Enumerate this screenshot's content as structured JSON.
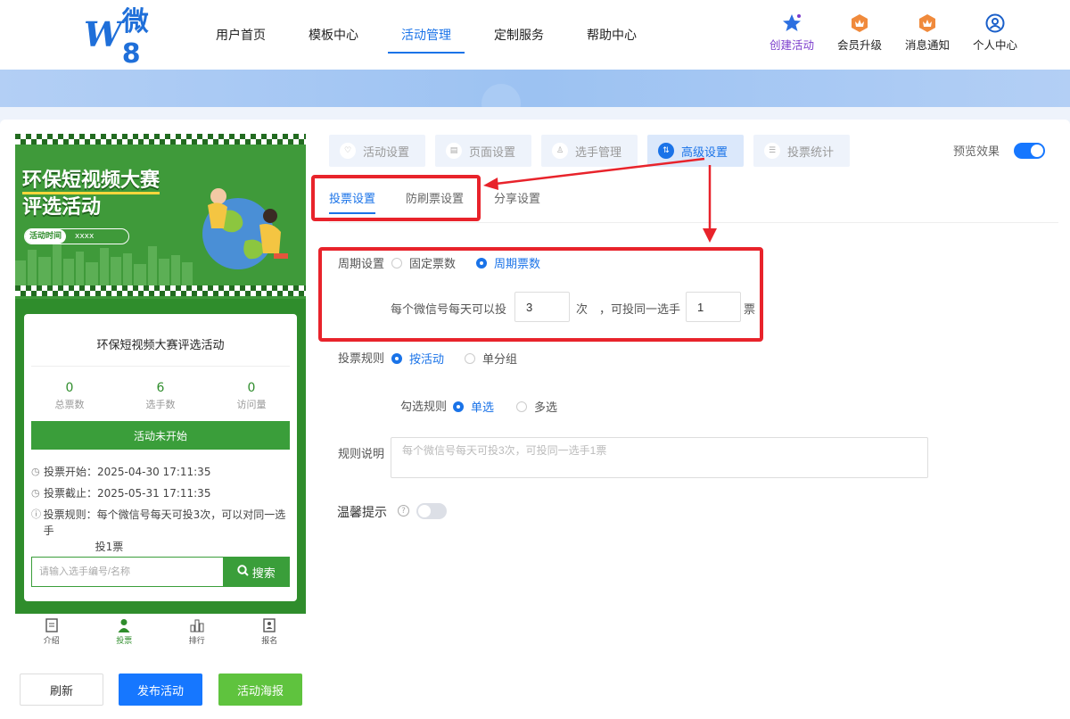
{
  "logo": {
    "mark": "W",
    "text": "微8"
  },
  "nav": {
    "items": [
      {
        "label": "用户首页"
      },
      {
        "label": "模板中心"
      },
      {
        "label": "活动管理"
      },
      {
        "label": "定制服务"
      },
      {
        "label": "帮助中心"
      }
    ],
    "right": [
      {
        "label": "创建活动",
        "icon": "star-icon"
      },
      {
        "label": "会员升级",
        "icon": "crown-icon"
      },
      {
        "label": "消息通知",
        "icon": "bell-icon"
      },
      {
        "label": "个人中心",
        "icon": "user-icon"
      }
    ]
  },
  "preview": {
    "poster_title_1": "环保短视频大赛",
    "poster_title_2": "评选活动",
    "time_label": "活动时间",
    "time_value": "xxxx",
    "card_title": "环保短视频大赛评选活动",
    "stats": [
      {
        "num": "0",
        "label": "总票数"
      },
      {
        "num": "6",
        "label": "选手数"
      },
      {
        "num": "0",
        "label": "访问量"
      }
    ],
    "status": "活动未开始",
    "vote_start": "投票开始：2025-04-30 17:11:35",
    "vote_end": "投票截止：2025-05-31 17:11:35",
    "vote_rule_1": "投票规则：每个微信号每天可投3次，可以对同一选手",
    "vote_rule_2": "投1票",
    "search_placeholder": "请输入选手编号/名称",
    "search_btn": "搜索",
    "tabs": [
      {
        "label": "介绍"
      },
      {
        "label": "投票"
      },
      {
        "label": "排行"
      },
      {
        "label": "报名"
      }
    ]
  },
  "bottom_buttons": {
    "refresh": "刷新",
    "publish": "发布活动",
    "poster": "活动海报"
  },
  "steps": [
    {
      "label": "活动设置"
    },
    {
      "label": "页面设置"
    },
    {
      "label": "选手管理"
    },
    {
      "label": "高级设置"
    },
    {
      "label": "投票统计"
    }
  ],
  "preview_toggle_label": "预览效果",
  "subtabs": [
    {
      "label": "投票设置"
    },
    {
      "label": "防刷票设置"
    },
    {
      "label": "分享设置"
    }
  ],
  "form": {
    "period_label": "周期设置",
    "period_fixed": "固定票数",
    "period_cycle": "周期票数",
    "per_day_text": "每个微信号每天可以投",
    "per_day_value": "3",
    "times_unit": "次",
    "same_player_text": "，可投同一选手",
    "same_player_value": "1",
    "votes_unit": "票",
    "rule_label": "投票规则",
    "rule_activity": "按活动",
    "rule_group": "单分组",
    "select_label": "勾选规则",
    "select_single": "单选",
    "select_multi": "多选",
    "desc_label": "规则说明",
    "desc_placeholder": "每个微信号每天可投3次，可投同一选手1票",
    "tip_label": "温馨提示"
  }
}
